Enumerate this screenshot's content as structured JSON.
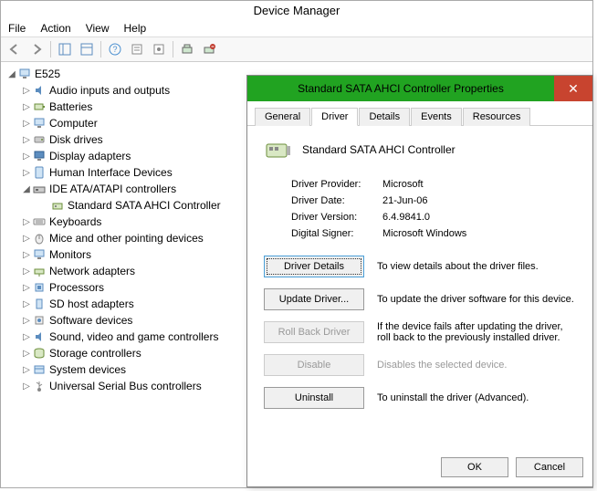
{
  "window": {
    "title": "Device Manager"
  },
  "menu": {
    "file": "File",
    "action": "Action",
    "view": "View",
    "help": "Help"
  },
  "tree": {
    "root": "E525",
    "items": [
      "Audio inputs and outputs",
      "Batteries",
      "Computer",
      "Disk drives",
      "Display adapters",
      "Human Interface Devices",
      "IDE ATA/ATAPI controllers",
      "Keyboards",
      "Mice and other pointing devices",
      "Monitors",
      "Network adapters",
      "Processors",
      "SD host adapters",
      "Software devices",
      "Sound, video and game controllers",
      "Storage controllers",
      "System devices",
      "Universal Serial Bus controllers"
    ],
    "ide_child": "Standard SATA AHCI Controller"
  },
  "dialog": {
    "title": "Standard SATA AHCI Controller Properties",
    "tabs": {
      "general": "General",
      "driver": "Driver",
      "details": "Details",
      "events": "Events",
      "resources": "Resources"
    },
    "device_name": "Standard SATA AHCI Controller",
    "info": {
      "provider_k": "Driver Provider:",
      "provider_v": "Microsoft",
      "date_k": "Driver Date:",
      "date_v": "21-Jun-06",
      "version_k": "Driver Version:",
      "version_v": "6.4.9841.0",
      "signer_k": "Digital Signer:",
      "signer_v": "Microsoft Windows"
    },
    "actions": {
      "details_btn": "Driver Details",
      "details_desc": "To view details about the driver files.",
      "update_btn": "Update Driver...",
      "update_desc": "To update the driver software for this device.",
      "rollback_btn": "Roll Back Driver",
      "rollback_desc": "If the device fails after updating the driver, roll back to the previously installed driver.",
      "disable_btn": "Disable",
      "disable_desc": "Disables the selected device.",
      "uninstall_btn": "Uninstall",
      "uninstall_desc": "To uninstall the driver (Advanced)."
    },
    "buttons": {
      "ok": "OK",
      "cancel": "Cancel"
    }
  }
}
